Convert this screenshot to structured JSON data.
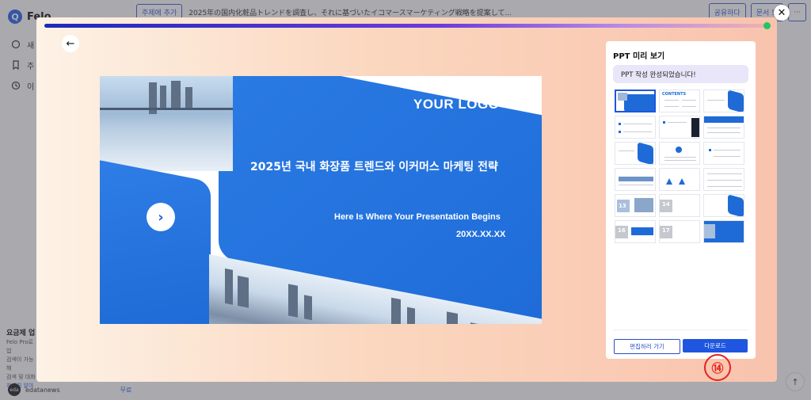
{
  "background": {
    "logo_mark": "Q",
    "logo_text": "Felo",
    "nav": [
      {
        "label": "새",
        "icon": "chat-icon"
      },
      {
        "label": "주",
        "icon": "bookmark-icon"
      },
      {
        "label": "이",
        "icon": "history-icon"
      }
    ],
    "topic_button": "주제에 추가",
    "query_text": "2025年の国内化粧品トレンドを調査し、それに基づいたイコマースマーケティング戦略を提案して...",
    "share_button": "공유하다",
    "doc_button": "문서 보",
    "more_button": "···",
    "promo_title": "요금제 업",
    "promo_line1": "Felo Pro로 업",
    "promo_line2": "검색이 가능해",
    "promo_line3": "검색 및 대화",
    "promo_link": "자세히 알아",
    "user_avatar": "eda",
    "username": "edatanews",
    "plan": "무료",
    "scroll_top": "↑"
  },
  "modal": {
    "progress": 1.0,
    "close": "✕",
    "back": "←",
    "slide": {
      "logo": "YOUR LOGO",
      "title": "2025년 국내 화장품 트렌드와 이커머스 마케팅 전략",
      "subtitle": "Here Is Where Your Presentation Begins",
      "date": "20XX.XX.XX",
      "arrow": "›"
    },
    "panel": {
      "title": "PPT 미리 보기",
      "status": "PPT 작성 완성되었습니다!",
      "thumbnail_numbers": [
        "",
        "",
        "",
        "",
        "",
        "",
        "",
        "",
        "",
        "",
        "",
        "",
        "",
        "",
        "",
        "",
        "",
        "",
        "",
        "",
        "",
        "",
        "",
        ""
      ],
      "labels": {
        "t2": "CONTENTS",
        "t8": "0",
        "t13": "13",
        "t14": "14",
        "t15": "0",
        "t16": "16",
        "t17": "17",
        "t18": "18"
      },
      "edit_button": "편집하러 가기",
      "download_button": "다운로드"
    },
    "step_marker": "⑭"
  },
  "colors": {
    "accent": "#1f56e0",
    "slide_blue": "#1e6bd8",
    "marker_red": "#e4231b",
    "success": "#22c55e"
  }
}
